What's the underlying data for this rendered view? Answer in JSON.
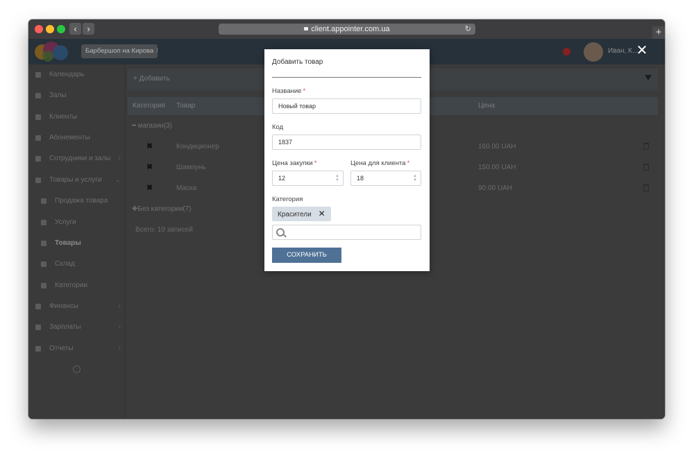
{
  "browser": {
    "url": "client.appointer.com.ua",
    "back": "‹",
    "forward": "›",
    "reload": "↻",
    "new_tab": "+"
  },
  "header": {
    "branch": "Барбершоп на Кирова",
    "user": "Иван, К...",
    "colors": {
      "topbar": "#27313a",
      "notification": "#8a1f1f"
    }
  },
  "sidebar": {
    "items": [
      {
        "label": "Календарь",
        "icon": "calendar-icon"
      },
      {
        "label": "Залы",
        "icon": "bookmark-icon"
      },
      {
        "label": "Клиенты",
        "icon": "users-icon"
      },
      {
        "label": "Абонементы",
        "icon": "card-icon"
      },
      {
        "label": "Сотрудники и залы",
        "icon": "staff-icon",
        "chevron": "›"
      },
      {
        "label": "Товары и услуги",
        "icon": "goods-icon",
        "chevron": "⌄"
      },
      {
        "label": "Продажа товара",
        "icon": "sale-icon",
        "sub": true
      },
      {
        "label": "Услуги",
        "icon": "scissors-icon",
        "sub": true
      },
      {
        "label": "Товары",
        "icon": "product-icon",
        "sub": true,
        "active": true
      },
      {
        "label": "Склад",
        "icon": "warehouse-icon",
        "sub": true
      },
      {
        "label": "Категории",
        "icon": "tag-icon",
        "sub": true
      },
      {
        "label": "Финансы",
        "icon": "money-icon",
        "chevron": "›"
      },
      {
        "label": "Зарплаты",
        "icon": "salary-icon",
        "chevron": "›"
      },
      {
        "label": "Отчеты",
        "icon": "chart-icon",
        "chevron": "›"
      }
    ]
  },
  "toolbar": {
    "add_label": "Добавить"
  },
  "table": {
    "headers": {
      "category": "Категория",
      "product": "Товар",
      "price": "Цена"
    },
    "group_shop": "магазин(3)",
    "rows": [
      {
        "name": "Кондиционер",
        "price": "160.00 UAH"
      },
      {
        "name": "Шампунь",
        "price": "150.00 UAH"
      },
      {
        "name": "Маска",
        "price": "90.00 UAH"
      }
    ],
    "group_none": "Без категории(7)",
    "total": "Всего: 10 записей"
  },
  "modal": {
    "title": "Добавить товар",
    "name_label": "Название",
    "name_value": "Новый товар",
    "code_label": "Код",
    "code_value": "1837",
    "purchase_label": "Цена закупки",
    "purchase_value": "12",
    "client_label": "Цена для клиента",
    "client_value": "18",
    "category_label": "Категория",
    "category_chip": "Красители",
    "chip_remove": "✕",
    "save_label": "СОХРАНИТЬ",
    "required_mark": "*",
    "close": "✕",
    "colors": {
      "save": "#4f7196",
      "chip": "#d6dde5",
      "required": "#d9534f"
    }
  }
}
